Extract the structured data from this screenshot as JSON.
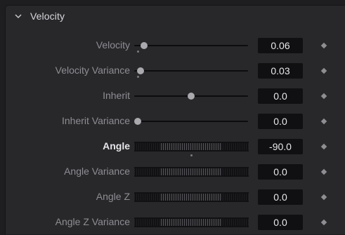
{
  "section": {
    "title": "Velocity",
    "expand_icon": "chevron-down-icon"
  },
  "rows": [
    {
      "label": "Velocity",
      "value": "0.06",
      "control": "slider",
      "level_fraction": 0.06
    },
    {
      "label": "Velocity Variance",
      "value": "0.03",
      "control": "slider",
      "level_fraction": 0.03
    },
    {
      "label": "Inherit",
      "value": "0.0",
      "control": "slider",
      "level_fraction": 0.5
    },
    {
      "label": "Inherit Variance",
      "value": "0.0",
      "control": "slider",
      "level_fraction": 0.0
    },
    {
      "label": "Angle",
      "value": "-90.0",
      "control": "thumbwheel",
      "active": true
    },
    {
      "label": "Angle Variance",
      "value": "0.0",
      "control": "thumbwheel"
    },
    {
      "label": "Angle Z",
      "value": "0.0",
      "control": "thumbwheel"
    },
    {
      "label": "Angle Z Variance",
      "value": "0.0",
      "control": "thumbwheel"
    }
  ],
  "keyframe_icon": "diamond-icon",
  "colors": {
    "panel": "#28282b",
    "value_box": "#101012",
    "label": "#8e8e93",
    "label_active": "#e6e6ea"
  }
}
